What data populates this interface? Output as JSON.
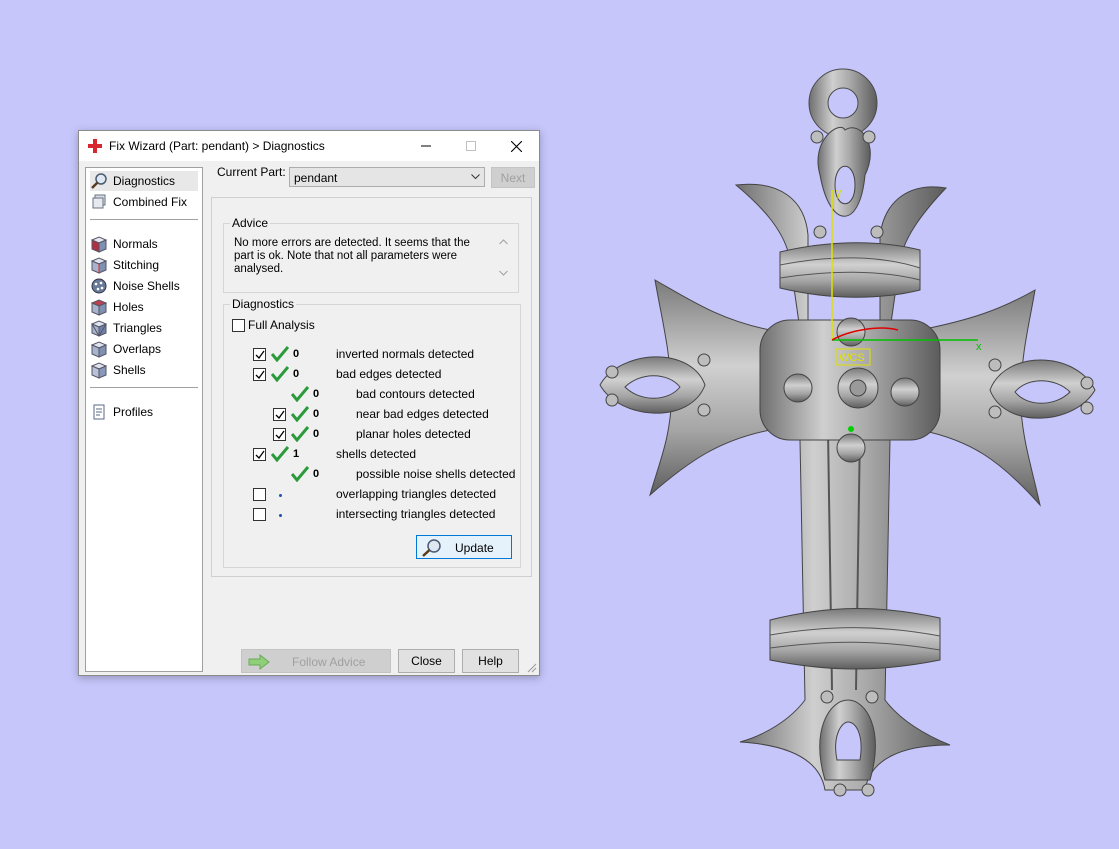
{
  "window": {
    "title": "Fix Wizard (Part: pendant) > Diagnostics",
    "app_icon": "red-cross-icon",
    "controls": [
      "minimize",
      "maximize",
      "close"
    ]
  },
  "sidebar": {
    "items": [
      {
        "label": "Diagnostics",
        "icon": "magnifier-icon",
        "active": true
      },
      {
        "label": "Combined Fix",
        "icon": "combined-fix-icon"
      },
      {
        "label": "Normals",
        "icon": "normals-cube-icon"
      },
      {
        "label": "Stitching",
        "icon": "stitching-cube-icon"
      },
      {
        "label": "Noise Shells",
        "icon": "noise-shells-icon"
      },
      {
        "label": "Holes",
        "icon": "holes-cube-icon"
      },
      {
        "label": "Triangles",
        "icon": "triangles-cube-icon"
      },
      {
        "label": "Overlaps",
        "icon": "overlaps-cube-icon"
      },
      {
        "label": "Shells",
        "icon": "shells-cube-icon"
      },
      {
        "label": "Profiles",
        "icon": "profiles-document-icon"
      }
    ]
  },
  "current_part": {
    "label": "Current Part:",
    "value": "pendant"
  },
  "next_button": "Next",
  "advice": {
    "title": "Advice",
    "text": "No more errors are detected. It seems that the part is ok. Note that not all parameters were analysed."
  },
  "diagnostics": {
    "title": "Diagnostics",
    "full_analysis": {
      "label": "Full Analysis",
      "checked": false
    },
    "rows": [
      {
        "checked": true,
        "status": "ok",
        "count": "0",
        "label": "inverted normals detected",
        "indent": 0
      },
      {
        "checked": true,
        "status": "ok",
        "count": "0",
        "label": "bad edges detected",
        "indent": 0
      },
      {
        "checked": null,
        "status": "ok",
        "count": "0",
        "label": "bad contours detected",
        "indent": 1
      },
      {
        "checked": true,
        "status": "ok",
        "count": "0",
        "label": "near bad edges detected",
        "indent": 1
      },
      {
        "checked": true,
        "status": "ok",
        "count": "0",
        "label": "planar holes detected",
        "indent": 1
      },
      {
        "checked": true,
        "status": "ok",
        "count": "1",
        "label": "shells detected",
        "indent": 0
      },
      {
        "checked": null,
        "status": "ok",
        "count": "0",
        "label": "possible noise shells detected",
        "indent": 1
      },
      {
        "checked": false,
        "status": "pending",
        "count": "",
        "label": "overlapping triangles detected",
        "indent": 0
      },
      {
        "checked": false,
        "status": "pending",
        "count": "",
        "label": "intersecting triangles detected",
        "indent": 0
      }
    ],
    "update_button": "Update"
  },
  "footer": {
    "follow_advice": "Follow Advice",
    "close": "Close",
    "help": "Help"
  },
  "viewport": {
    "wcs_label": "WCS",
    "axis_labels": {
      "x": "x",
      "y": "y"
    },
    "colors": {
      "background": "#c6c6fb",
      "x_axis": "#00c000",
      "y_axis": "#e0e000",
      "z_axis": "#e00000"
    }
  }
}
